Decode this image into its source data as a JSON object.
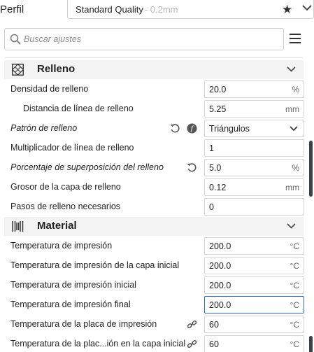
{
  "profile": {
    "label": "Perfil",
    "quality": "Standard Quality",
    "layer_height": "- 0.2mm"
  },
  "search": {
    "placeholder": "Buscar ajustes"
  },
  "categories": {
    "infill": {
      "title": "Relleno",
      "icon": "infill-grid-icon"
    },
    "material": {
      "title": "Material",
      "icon": "material-spool-icon"
    }
  },
  "infill_settings": [
    {
      "label": "Densidad de relleno",
      "value": "20.0",
      "unit": "%"
    },
    {
      "label": "Distancia de línea de relleno",
      "value": "5.25",
      "unit": "mm"
    },
    {
      "label": "Patrón de relleno",
      "value": "Triángulos",
      "unit": ""
    },
    {
      "label": "Multiplicador de línea de relleno",
      "value": "1",
      "unit": ""
    },
    {
      "label": "Porcentaje de superposición del relleno",
      "value": "5.0",
      "unit": "%"
    },
    {
      "label": "Grosor de la capa de relleno",
      "value": "0.12",
      "unit": "mm"
    },
    {
      "label": "Pasos de relleno necesarios",
      "value": "0",
      "unit": ""
    }
  ],
  "material_settings": [
    {
      "label": "Temperatura de impresión",
      "value": "200.0",
      "unit": "°C"
    },
    {
      "label": "Temperatura de impresión de la capa inicial",
      "value": "200.0",
      "unit": "°C"
    },
    {
      "label": "Temperatura de impresión inicial",
      "value": "200.0",
      "unit": "°C"
    },
    {
      "label": "Temperatura de impresión final",
      "value": "200.0",
      "unit": "°C"
    },
    {
      "label": "Temperatura de la placa de impresión",
      "value": "60",
      "unit": "°C"
    },
    {
      "label": "Temperatura de la plac...ión en la capa inicial",
      "value": "60",
      "unit": "°C"
    }
  ],
  "colors": {
    "accent": "#2a6ad2",
    "category_bg": "#f3f3f3",
    "scrollbar": "#3a3f4b"
  }
}
